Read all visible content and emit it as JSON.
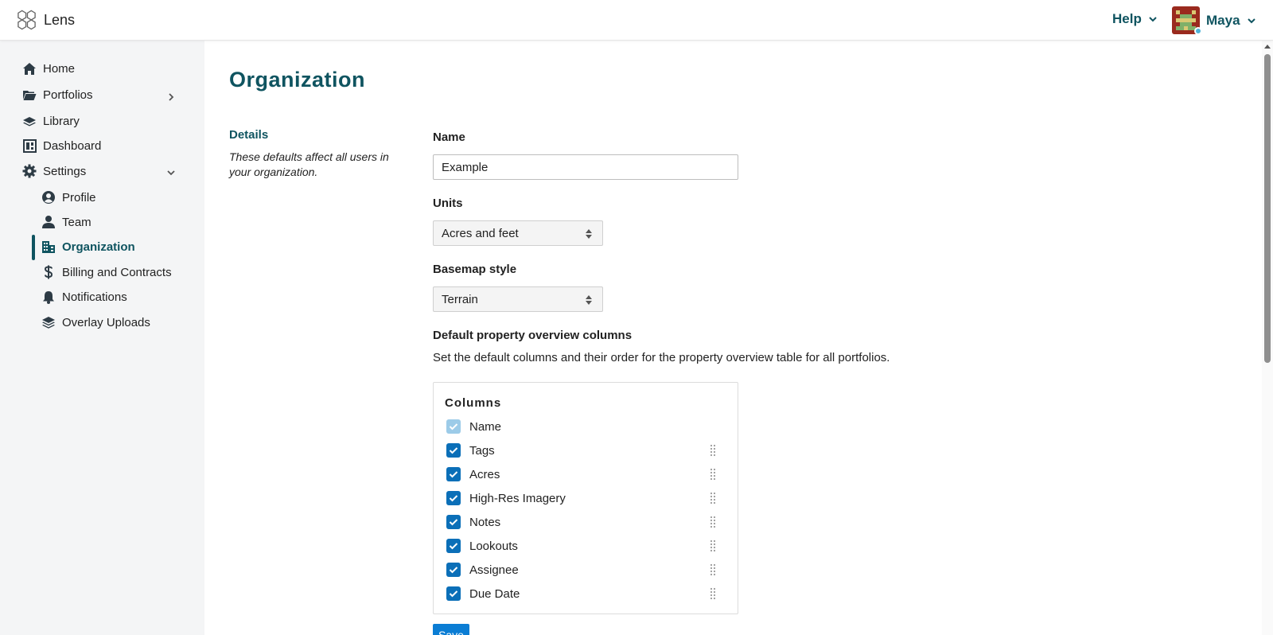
{
  "app": {
    "name": "Lens"
  },
  "header": {
    "help_label": "Help",
    "user_name": "Maya"
  },
  "sidebar": {
    "items": [
      {
        "label": "Home",
        "icon": "home-icon"
      },
      {
        "label": "Portfolios",
        "icon": "folder-icon",
        "expandable": true,
        "expanded": false
      },
      {
        "label": "Library",
        "icon": "layers-icon"
      },
      {
        "label": "Dashboard",
        "icon": "dashboard-icon"
      },
      {
        "label": "Settings",
        "icon": "gear-icon",
        "expandable": true,
        "expanded": true
      }
    ],
    "settings_children": [
      {
        "label": "Profile",
        "icon": "user-circle-icon"
      },
      {
        "label": "Team",
        "icon": "user-icon"
      },
      {
        "label": "Organization",
        "icon": "building-icon",
        "active": true
      },
      {
        "label": "Billing and Contracts",
        "icon": "dollar-icon"
      },
      {
        "label": "Notifications",
        "icon": "bell-icon"
      },
      {
        "label": "Overlay Uploads",
        "icon": "layers-upload-icon"
      }
    ]
  },
  "page": {
    "title": "Organization",
    "section_title": "Details",
    "section_description": "These defaults affect all users in your organization.",
    "name_label": "Name",
    "name_value": "Example",
    "units_label": "Units",
    "units_value": "Acres and feet",
    "basemap_label": "Basemap style",
    "basemap_value": "Terrain",
    "columns_section_label": "Default property overview columns",
    "columns_helper": "Set the default columns and their order for the property overview table for all portfolios.",
    "columns_title": "Columns",
    "columns": [
      {
        "label": "Name",
        "checked": true,
        "locked": true
      },
      {
        "label": "Tags",
        "checked": true
      },
      {
        "label": "Acres",
        "checked": true
      },
      {
        "label": "High-Res Imagery",
        "checked": true
      },
      {
        "label": "Notes",
        "checked": true
      },
      {
        "label": "Lookouts",
        "checked": true
      },
      {
        "label": "Assignee",
        "checked": true
      },
      {
        "label": "Due Date",
        "checked": true
      }
    ],
    "save_label": "Save"
  },
  "colors": {
    "accent": "#0f5460",
    "checkbox": "#0b6fb8",
    "button": "#0b7dd4",
    "sidebar_bg": "#f4f5f6"
  }
}
